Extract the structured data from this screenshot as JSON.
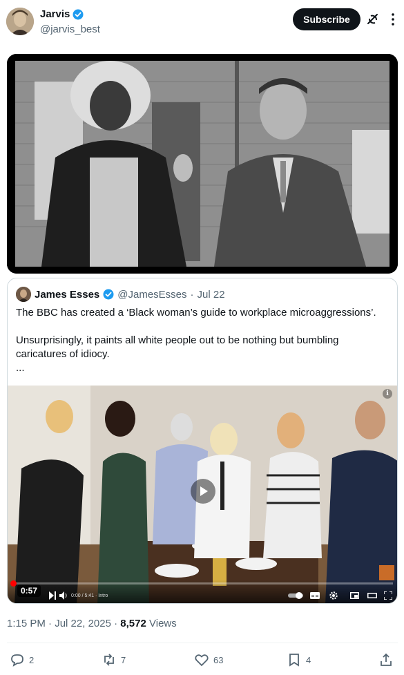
{
  "author": {
    "display_name": "Jarvis",
    "handle": "@jarvis_best",
    "verified_icon": "verified-badge-icon"
  },
  "header": {
    "subscribe_label": "Subscribe",
    "grok_icon": "grok-icon",
    "more_icon": "more-icon"
  },
  "main_media": {
    "description_icon": "photo"
  },
  "quoted_post": {
    "display_name": "James Esses",
    "handle": "@JamesEsses",
    "separator": "·",
    "date": "Jul 22",
    "paragraphs": [
      "The BBC has created a ‘Black woman’s guide to workplace microaggressions’.",
      "",
      "Unsurprisingly, it paints all white people out to be nothing but bumbling caricatures of idiocy.",
      "..."
    ],
    "video": {
      "timestamp": "0:57",
      "player_time": "0:00 / 5:41 · Intro",
      "progress_fraction": 0.0,
      "info_label": "i"
    }
  },
  "meta": {
    "time": "1:15 PM",
    "separator": "·",
    "date": "Jul 22, 2025",
    "views_count": "8,572",
    "views_label": "Views"
  },
  "actions": {
    "replies": "2",
    "reposts": "7",
    "likes": "63",
    "bookmarks": "4"
  },
  "colors": {
    "text": "#0f1419",
    "muted": "#536471",
    "verified": "#1d9bf0",
    "border": "#cfd9de"
  }
}
